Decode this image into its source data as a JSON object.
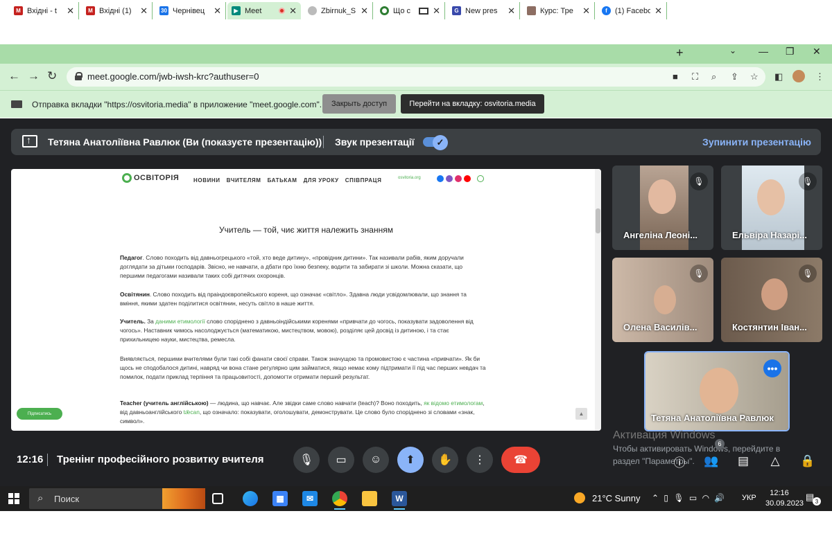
{
  "browser": {
    "tabs": [
      {
        "title": "Вхідні - t",
        "favicon": "gmail-icon",
        "color": "#c5221f"
      },
      {
        "title": "Вхідні (1)",
        "favicon": "gmail-icon",
        "color": "#c5221f"
      },
      {
        "title": "Чернівец",
        "favicon": "calendar-icon",
        "color": "#1a73e8"
      },
      {
        "title": "Meet",
        "favicon": "meet-icon",
        "color": "#00897b",
        "active": true
      },
      {
        "title": "Zbirnuk_S",
        "favicon": "loading-icon",
        "color": "#888888"
      },
      {
        "title": "Що с",
        "favicon": "circle-icon",
        "color": "#2e7d32"
      },
      {
        "title": "New pres",
        "favicon": "gamma-icon",
        "color": "#3949ab"
      },
      {
        "title": "Курс: Тре",
        "favicon": "course-icon",
        "color": "#8d6e63"
      },
      {
        "title": "(1) Facebo",
        "favicon": "facebook-icon",
        "color": "#1877f2"
      }
    ],
    "new_tab": "+",
    "url": "meet.google.com/jwb-iwsh-krc?authuser=0"
  },
  "infobar": {
    "message": "Отправка вкладки \"https://osvitoria.media\" в приложение \"meet.google.com\"...",
    "stop_button": "Закрыть доступ",
    "switch_button": "Перейти на вкладку: osvitoria.media"
  },
  "presentation_bar": {
    "presenter": "Тетяна Анатоліївна Равлюк (Ви (показуєте презентацію))",
    "sound_label": "Звук презентації",
    "sound_on": true,
    "stop_label": "Зупинити презентацію"
  },
  "shared_page": {
    "logo": "ОСВІТОРІЯ",
    "nav": [
      "НОВИНИ",
      "ВЧИТЕЛЯМ",
      "БАТЬКАМ",
      "ДЛЯ УРОКУ",
      "СПІВПРАЦЯ"
    ],
    "site": "osvitoria.org",
    "title": "Учитель — той, чиє життя належить знанням",
    "p1_term": "Педагог",
    "p1": ". Слово походить від давньогрецького «той, хто веде дитину», «провідник дитини». Так називали рабів, яким доручали доглядати за дітьми господарів. Звісно, не навчати, а дбати про їхню безпеку, водити та забирати зі школи. Можна сказати, що першими педагогами називали таких собі дитячих охоронців.",
    "p2_term": "Освітянин",
    "p2": ". Слово походить від праіндоєвропейського кореня, що означає «світло». Здавна люди усвідомлювали, що знання та вміння, якими здатен поділитися освітянин, несуть світло в наше життя.",
    "p3_term": "Учитель.",
    "p3_a": " За ",
    "p3_link": "даними етимології",
    "p3_b": " слово споріднено з давньоіндійськими коренями «привчати до чогось, показувати задоволення від чогось». Наставник чимось насолоджується (математикою, мистецтвом, мовою), розділяє цей досвід із дитиною, і та стає прихильницею науки, мистецтва, ремесла.",
    "p4": "Виявляється, першими вчителями були такі собі фанати своєї справи. Також значущою та промовистою є частина «привчати». Як би щось не сподобалося дитині, навряд чи вона стане регулярно цим займатися, якщо немає кому підтримати її під час перших невдач та помилок, подати приклад терпіння та працьовитості, допомогти отримати перший результат.",
    "p5_term": "Teacher (учитель англійською)",
    "p5_a": " —  людина, що навчає. Але звідки саме слово навчати (teach)? Воно походить, ",
    "p5_link": "як відомо етимологам",
    "p5_b": ", від давньоанглійського ",
    "p5_link2": "tǣcan",
    "p5_c": ", що означало: показувати, оголошувати, демонструвати. Це слово було споріднено зі словами «знак, символ».",
    "subscribe": "Підписатись"
  },
  "participants": [
    {
      "name": "Ангеліна Леоні...",
      "muted": true
    },
    {
      "name": "Ельвіра Назарі...",
      "muted": true
    },
    {
      "name": "Олена Василів...",
      "muted": true
    },
    {
      "name": "Костянтин Іван...",
      "muted": true
    },
    {
      "name": "Тетяна Анатоліївна Равлюк",
      "muted": false,
      "self": true
    }
  ],
  "meeting": {
    "time": "12:16",
    "title": "Тренінг професійного розвитку вчителя",
    "people_count": "6"
  },
  "watermark": {
    "line1": "Активация Windows",
    "line2": "Чтобы активировать Windows, перейдите в",
    "line3": "раздел \"Параметры\"."
  },
  "taskbar": {
    "search": "Поиск",
    "weather": "21°C  Sunny",
    "lang": "УКР",
    "time": "12:16",
    "date": "30.09.2023",
    "notifications": "3"
  }
}
